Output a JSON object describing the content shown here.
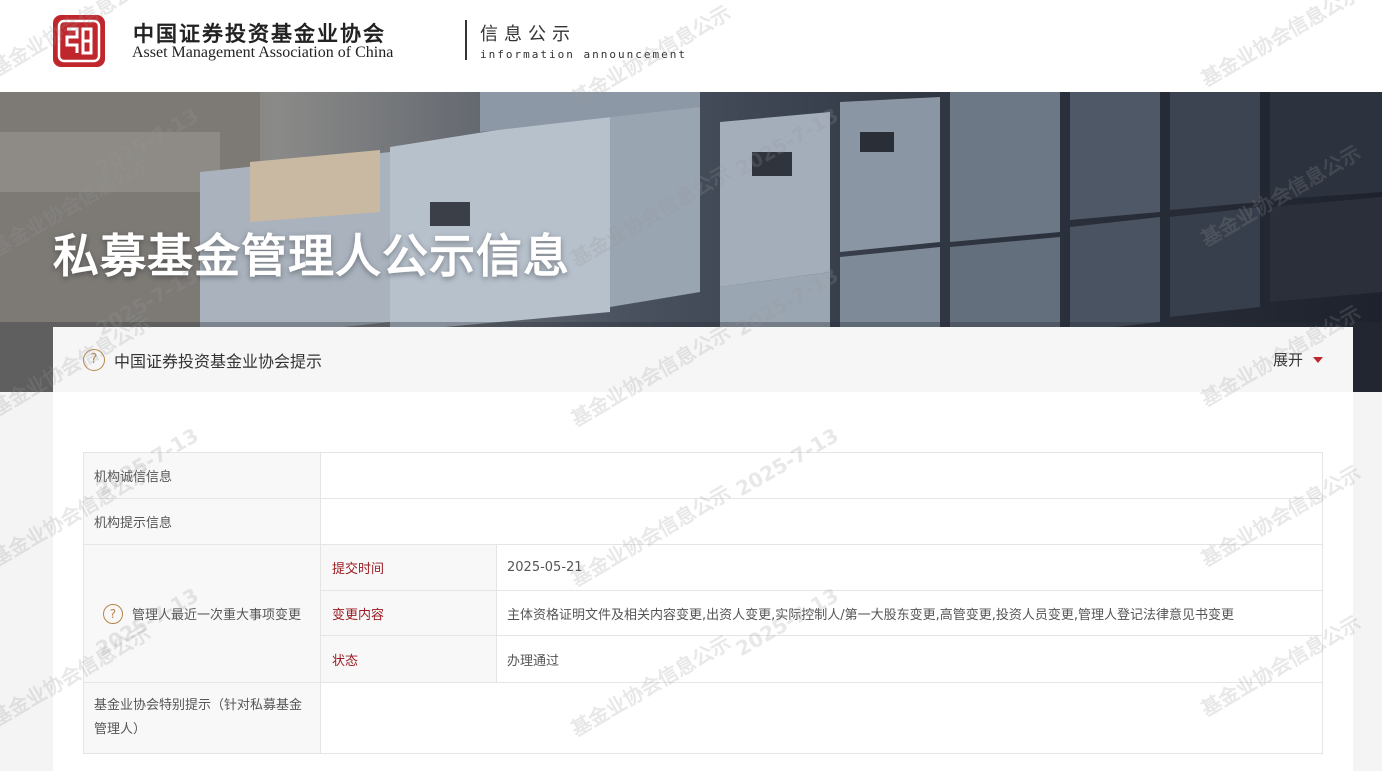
{
  "header": {
    "org_name_cn": "中国证券投资基金业协会",
    "org_name_en": "Asset Management Association of China",
    "section_cn": "信息公示",
    "section_en": "information announcement"
  },
  "banner": {
    "title": "私募基金管理人公示信息"
  },
  "notice": {
    "icon": "question-circle-icon",
    "title": "中国证券投资基金业协会提示",
    "expand_label": "展开",
    "accent_color": "#c0272d"
  },
  "table": {
    "rows": {
      "credit": {
        "label": "机构诚信信息",
        "value": ""
      },
      "hint": {
        "label": "机构提示信息",
        "value": ""
      },
      "major_change": {
        "label": "管理人最近一次重大事项变更",
        "submit_time": {
          "label": "提交时间",
          "value": "2025-05-21"
        },
        "change_content": {
          "label": "变更内容",
          "value": "主体资格证明文件及相关内容变更,出资人变更,实际控制人/第一大股东变更,高管变更,投资人员变更,管理人登记法律意见书变更"
        },
        "status": {
          "label": "状态",
          "value": "办理通过"
        }
      },
      "special_notice": {
        "label": "基金业协会特别提示（针对私募基金管理人）",
        "value": ""
      }
    }
  },
  "watermark": {
    "text_a": "基金业协会信息公示",
    "text_b": "2025-7-13"
  }
}
